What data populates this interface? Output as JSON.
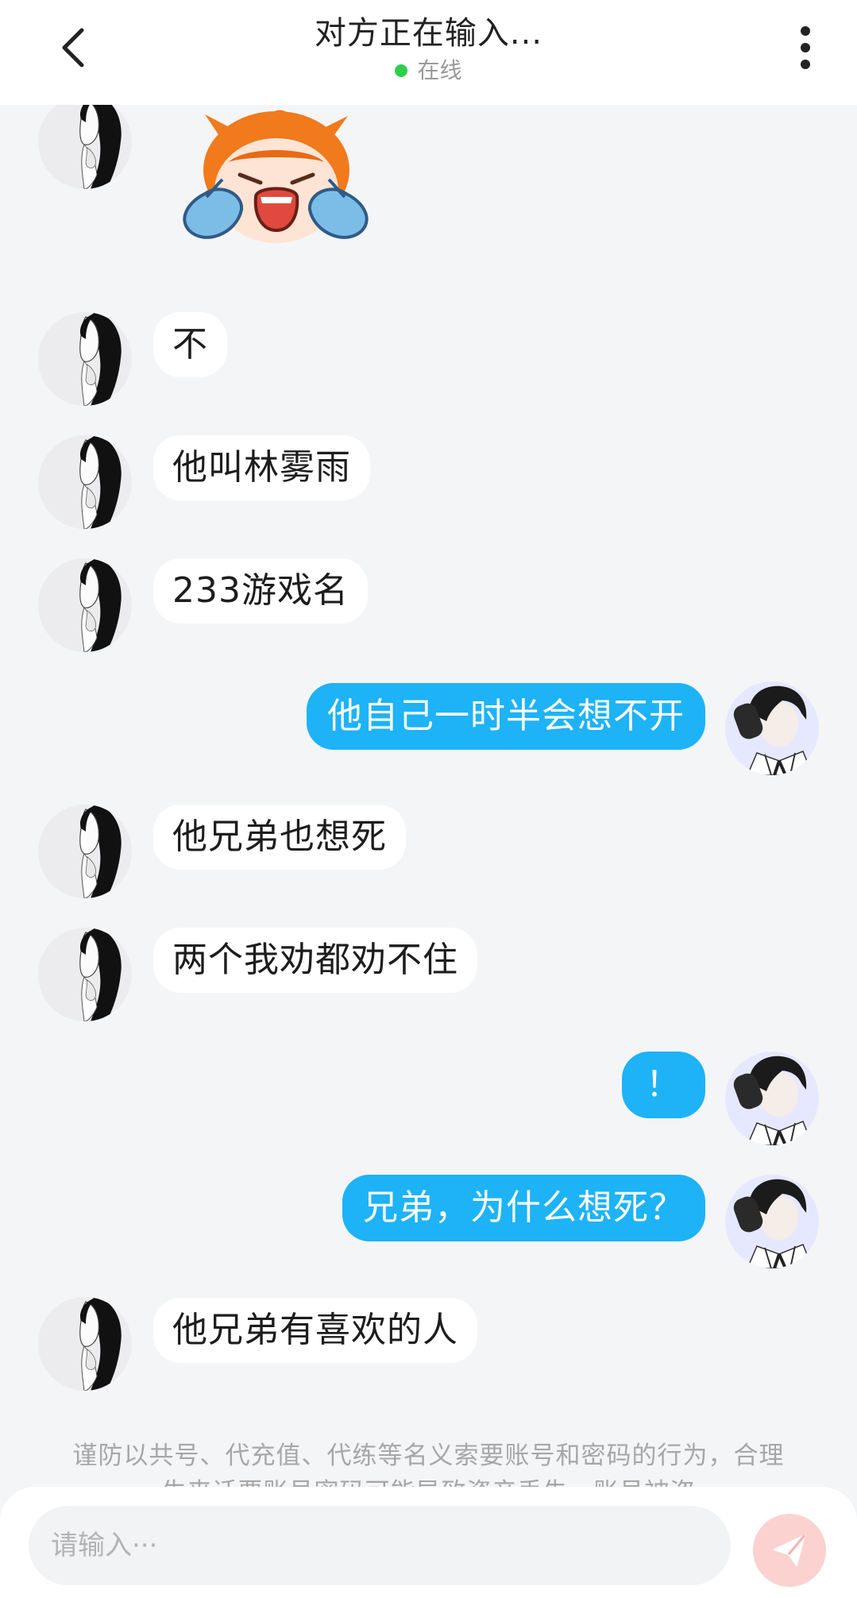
{
  "header": {
    "title": "对方正在输入...",
    "status": "在线",
    "online_color": "#2fce4d",
    "back_icon": "chevron-left-icon",
    "menu_icon": "more-vertical-icon"
  },
  "messages": [
    {
      "side": "left",
      "type": "sticker",
      "sticker": "crying-cartoon-sticker"
    },
    {
      "side": "left",
      "type": "text",
      "text": "不"
    },
    {
      "side": "left",
      "type": "text",
      "text": "他叫林雾雨"
    },
    {
      "side": "left",
      "type": "text",
      "text": "233游戏名"
    },
    {
      "side": "right",
      "type": "text",
      "text": "他自己一时半会想不开"
    },
    {
      "side": "left",
      "type": "text",
      "text": "他兄弟也想死"
    },
    {
      "side": "left",
      "type": "text",
      "text": "两个我劝都劝不住"
    },
    {
      "side": "right",
      "type": "text",
      "text": "！"
    },
    {
      "side": "right",
      "type": "text",
      "text": "兄弟，为什么想死？"
    },
    {
      "side": "left",
      "type": "text",
      "text": "他兄弟有喜欢的人"
    }
  ],
  "notice": "谨防以共号、代充值、代练等名义索要账号和密码的行为，合理生来话要账号密码可能导致资产丢失，账号被盗",
  "input": {
    "placeholder": "请输入···",
    "value": "",
    "send_icon": "paper-plane-icon"
  },
  "colors": {
    "bubble_self": "#1db3f6",
    "bubble_other": "#ffffff",
    "background": "#f4f5f7",
    "send_button": "#fbd2d0"
  }
}
